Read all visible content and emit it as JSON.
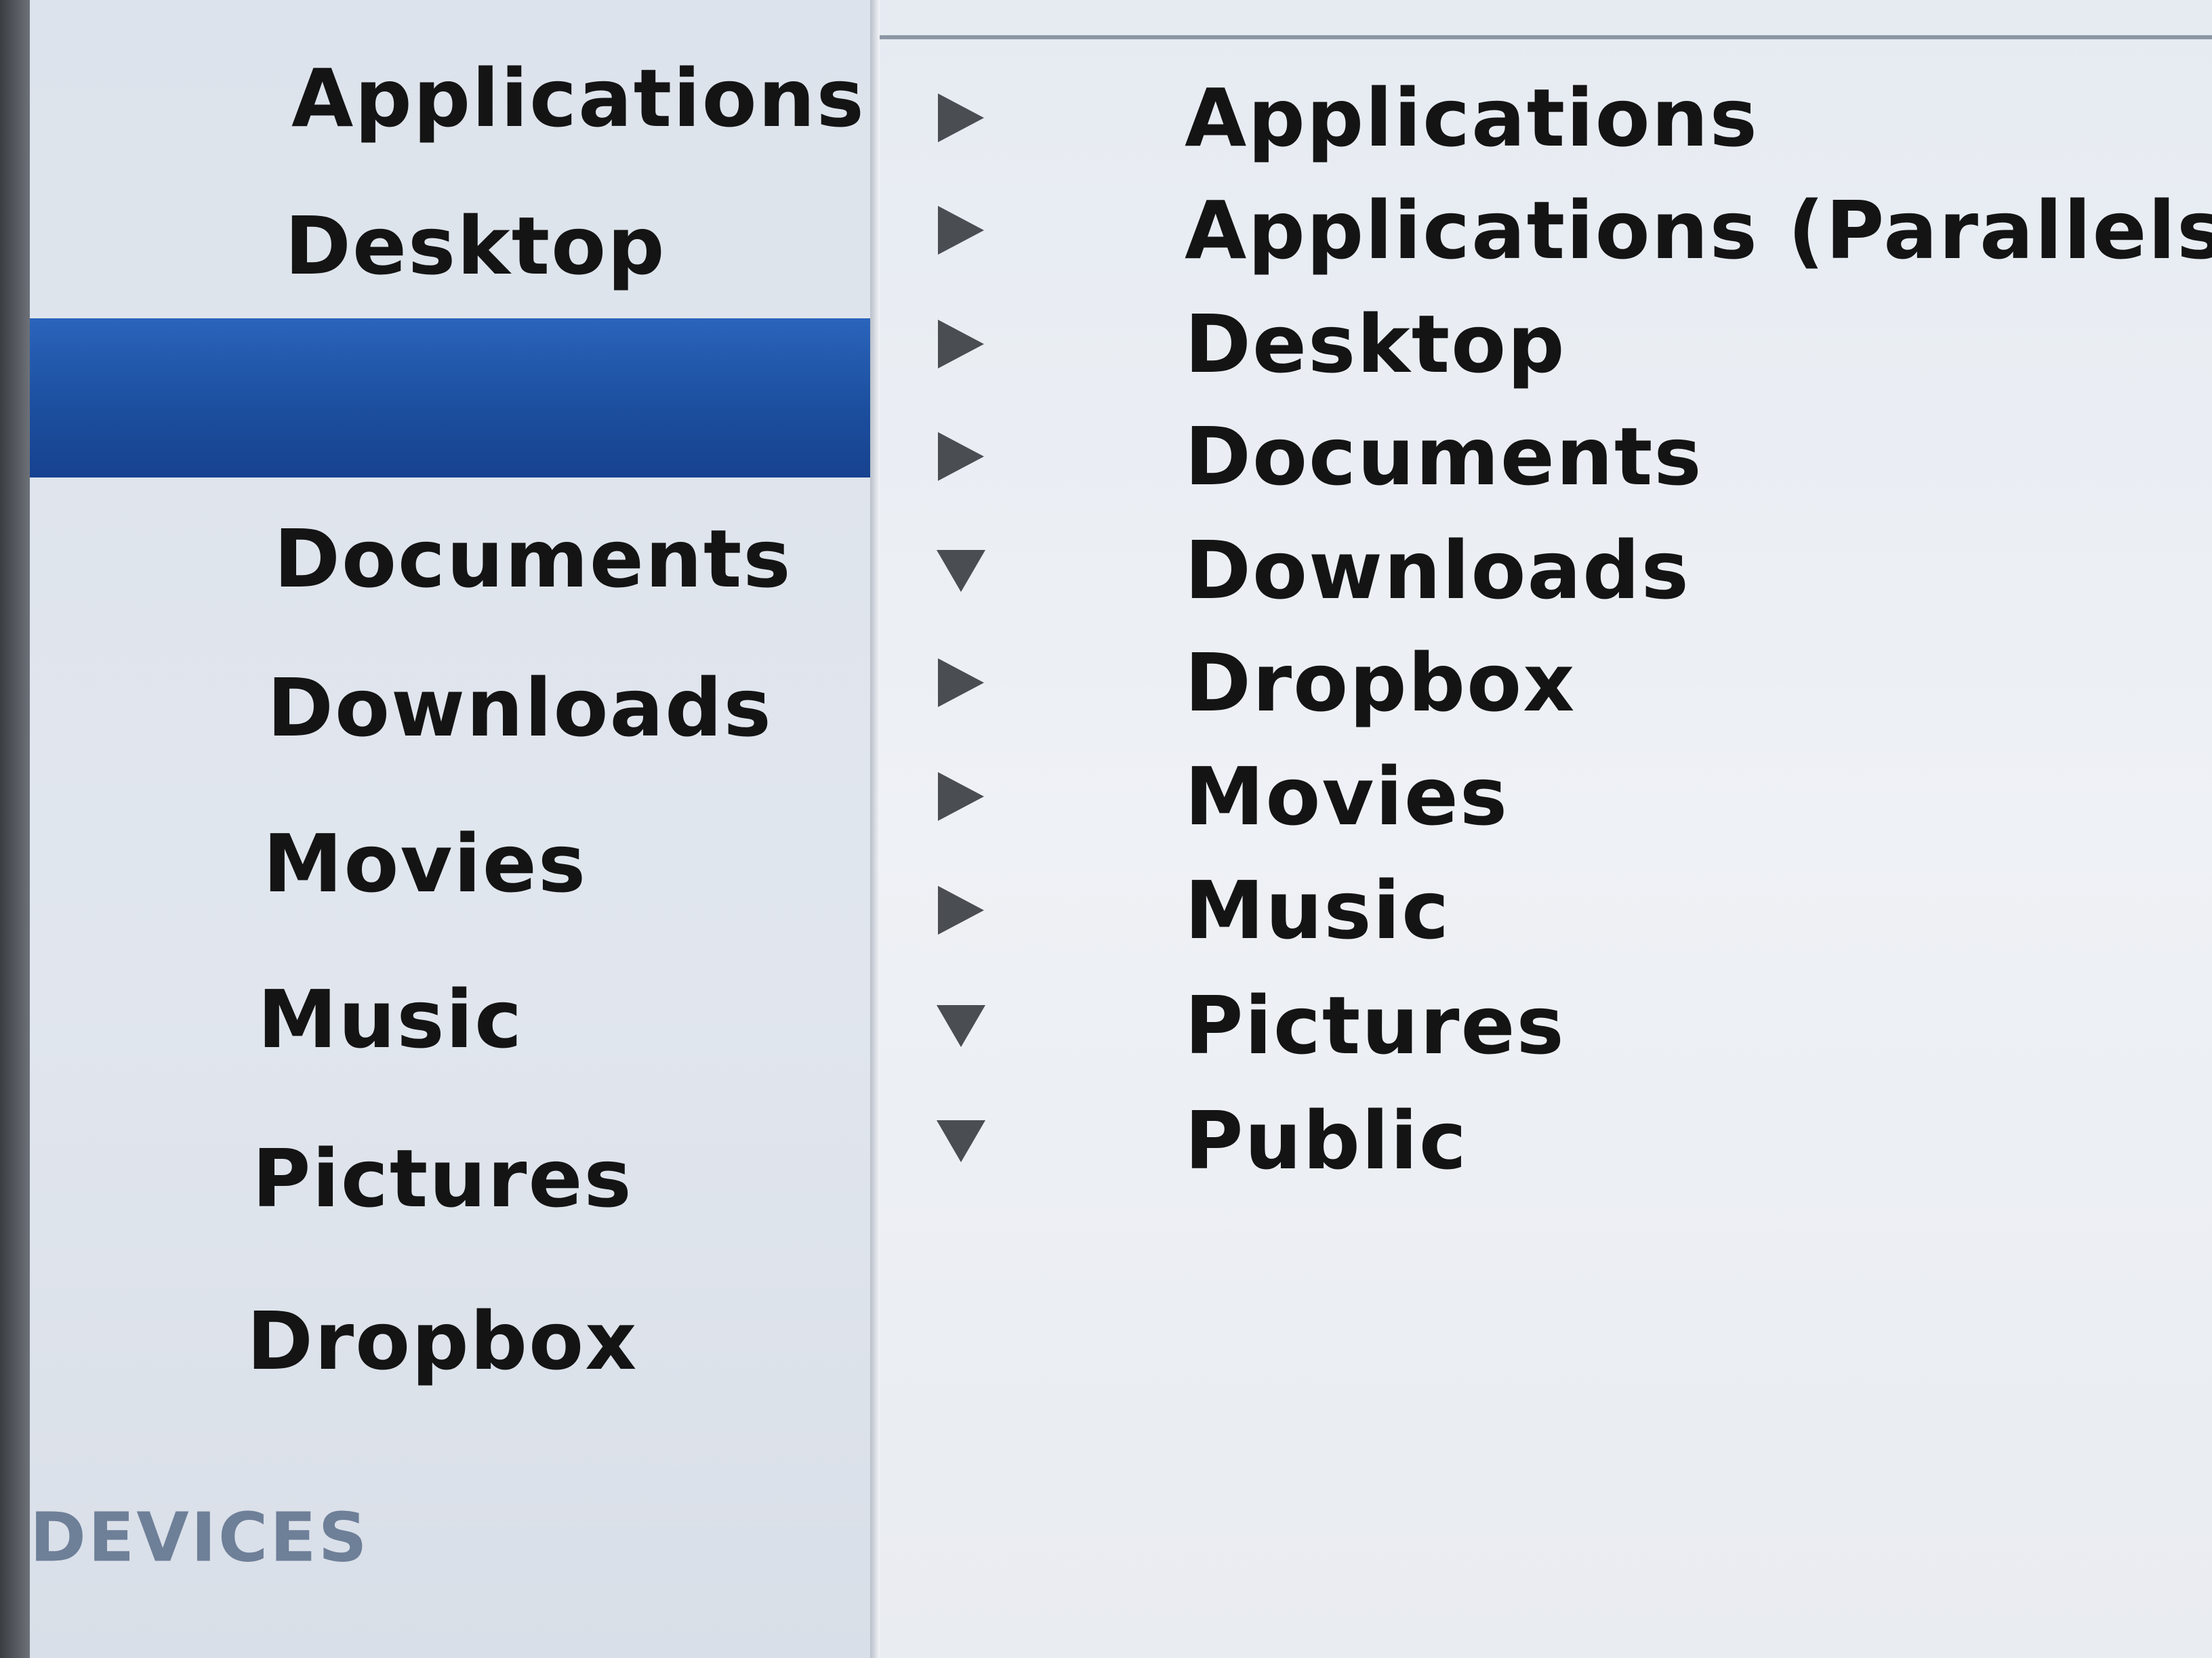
{
  "sidebar": {
    "items": [
      {
        "label": "Applications",
        "selected": false
      },
      {
        "label": "Desktop",
        "selected": false
      },
      {
        "label": "",
        "selected": true
      },
      {
        "label": "Documents",
        "selected": false
      },
      {
        "label": "Downloads",
        "selected": false
      },
      {
        "label": "Movies",
        "selected": false
      },
      {
        "label": "Music",
        "selected": false
      },
      {
        "label": "Pictures",
        "selected": false
      },
      {
        "label": "Dropbox",
        "selected": false
      }
    ],
    "devices_header": "DEVICES"
  },
  "file_list": {
    "rows": [
      {
        "name": "Applications",
        "disclosure": "collapsed"
      },
      {
        "name": "Applications (Parallels)",
        "disclosure": "collapsed"
      },
      {
        "name": "Desktop",
        "disclosure": "collapsed"
      },
      {
        "name": "Documents",
        "disclosure": "collapsed"
      },
      {
        "name": "Downloads",
        "disclosure": "expanded"
      },
      {
        "name": "Dropbox",
        "disclosure": "collapsed"
      },
      {
        "name": "Movies",
        "disclosure": "collapsed"
      },
      {
        "name": "Music",
        "disclosure": "collapsed"
      },
      {
        "name": "Pictures",
        "disclosure": "expanded"
      },
      {
        "name": "Public",
        "disclosure": "expanded"
      }
    ]
  },
  "colors": {
    "selection": "#1c4f9f",
    "text": "#141414",
    "section_header": "#6e7f98",
    "disclosure": "#4a4d52"
  },
  "icons": {
    "collapsed": "disclosure-triangle-right-icon",
    "expanded": "disclosure-triangle-down-icon"
  }
}
